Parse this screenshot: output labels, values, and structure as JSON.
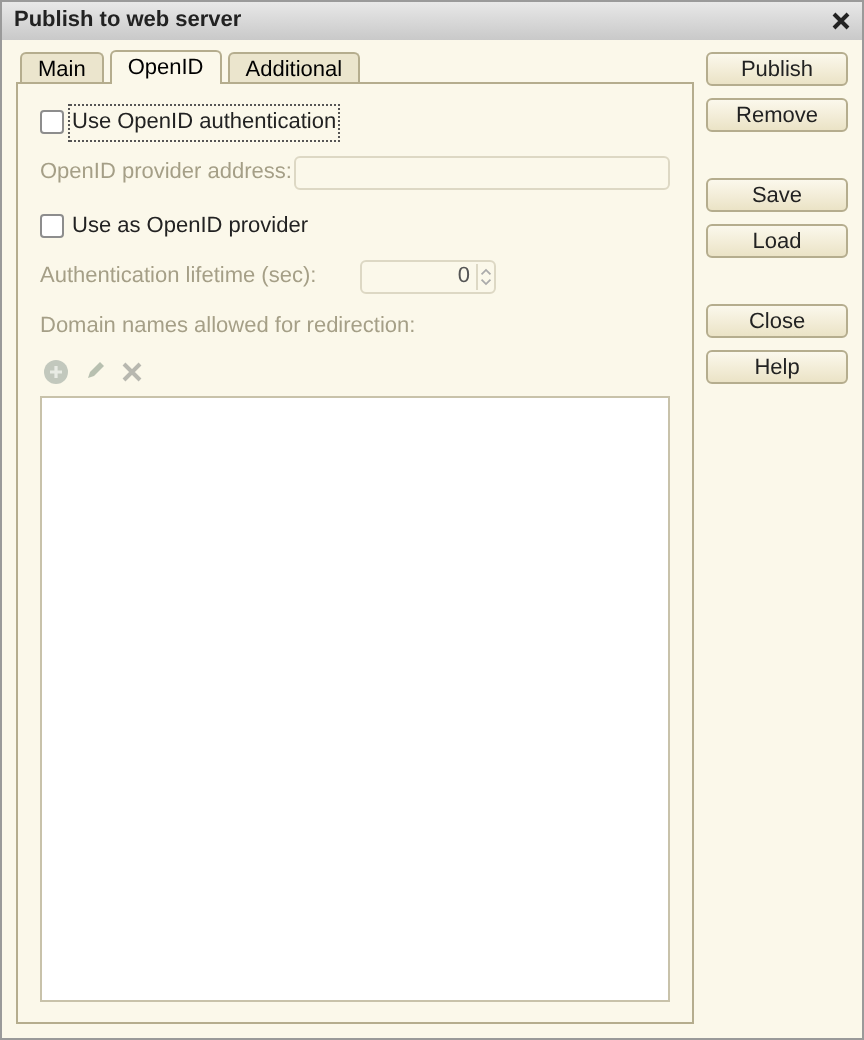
{
  "window": {
    "title": "Publish to web server"
  },
  "tabs": [
    {
      "label": "Main",
      "selected": false
    },
    {
      "label": "OpenID",
      "selected": true
    },
    {
      "label": "Additional",
      "selected": false
    }
  ],
  "use_openid": {
    "label": "Use OpenID authentication",
    "checked": false,
    "focused": true
  },
  "provider_address": {
    "label": "OpenID provider address:",
    "disabled": true
  },
  "use_as_provider": {
    "label": "Use as OpenID provider",
    "checked": false
  },
  "lifetime": {
    "label": "Authentication lifetime (sec):",
    "value": "0",
    "disabled": true
  },
  "domains": {
    "label": "Domain names allowed for redirection:",
    "disabled": true
  },
  "button_groups": [
    [
      "Publish",
      "Remove"
    ],
    [
      "Save",
      "Load"
    ],
    [
      "Close",
      "Help"
    ]
  ]
}
